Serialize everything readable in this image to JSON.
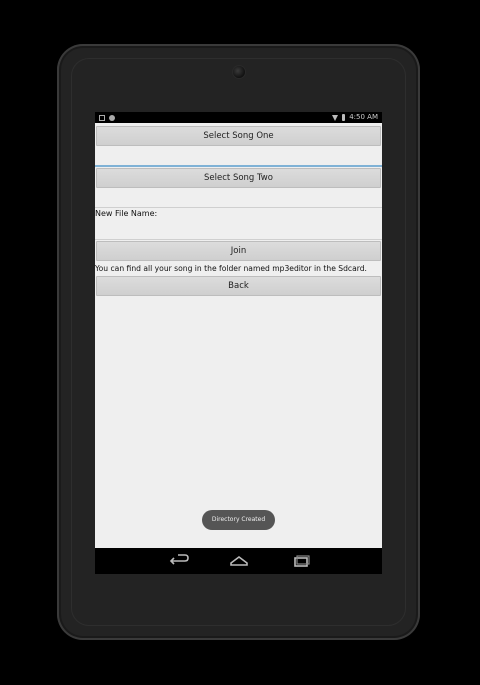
{
  "status_bar": {
    "time": "4:50 AM",
    "left_icons": [
      "image-icon",
      "notification-icon"
    ],
    "right_icons": [
      "wifi-icon",
      "battery-icon"
    ]
  },
  "app": {
    "select_song_one_label": "Select Song One",
    "song_one_value": "",
    "select_song_two_label": "Select Song Two",
    "song_two_value": "",
    "new_file_name_label": "New File Name:",
    "new_file_name_value": "",
    "join_label": "Join",
    "info_text": "You can find all your song in the folder named mp3editor in the Sdcard.",
    "back_label": "Back"
  },
  "toast": {
    "text": "Directory Created"
  },
  "nav_bar": {
    "icons": [
      "back-icon",
      "home-icon",
      "recents-icon"
    ]
  }
}
